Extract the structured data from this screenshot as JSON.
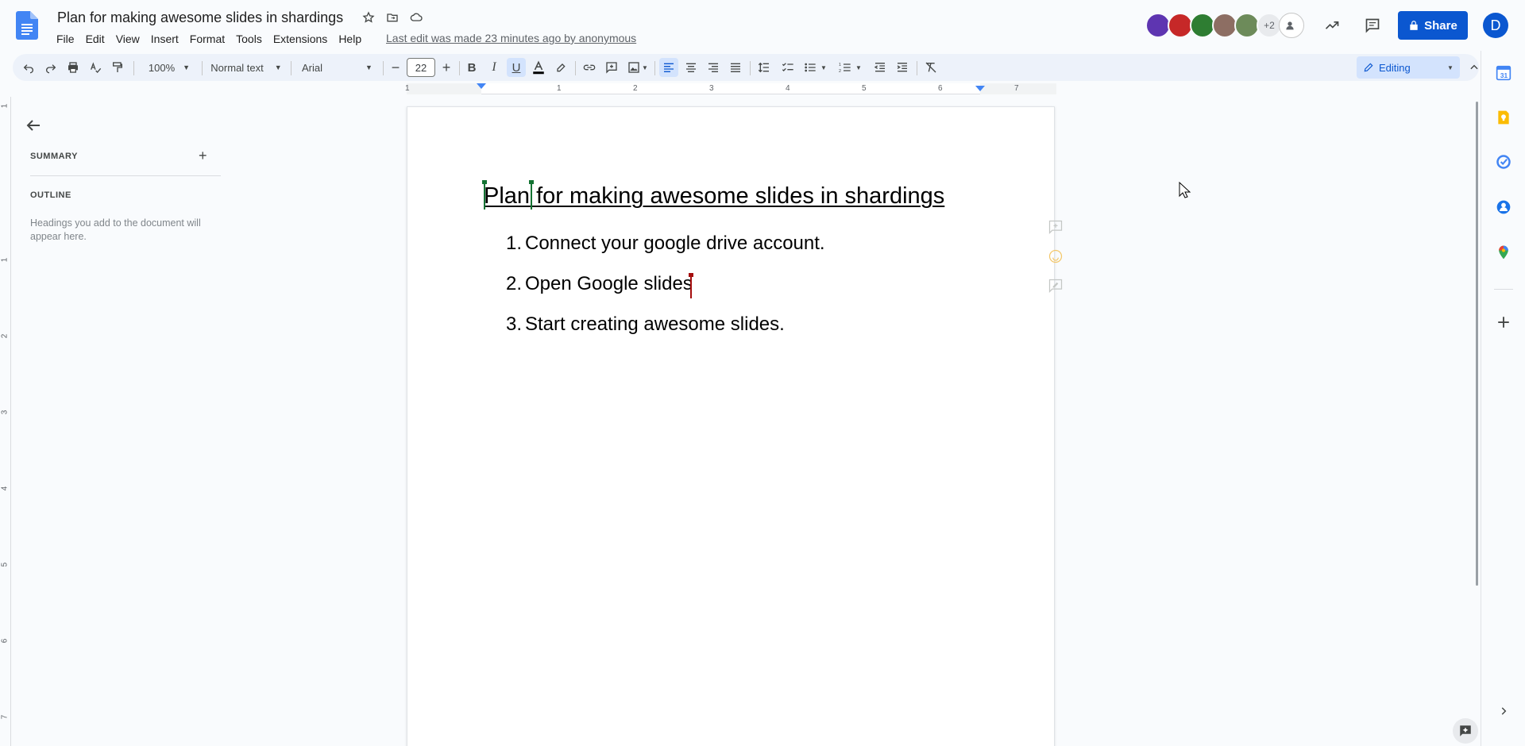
{
  "header": {
    "title": "Plan for making awesome slides in shardings",
    "last_edit": "Last edit was made 23 minutes ago by anonymous",
    "menu": [
      "File",
      "Edit",
      "View",
      "Insert",
      "Format",
      "Tools",
      "Extensions",
      "Help"
    ],
    "collaborators_more": "+2",
    "share_label": "Share",
    "user_initial": "D"
  },
  "toolbar": {
    "zoom": "100%",
    "style": "Normal text",
    "font": "Arial",
    "font_size": "22",
    "mode": "Editing"
  },
  "ruler": {
    "h_numbers": [
      "1",
      "1",
      "2",
      "3",
      "4",
      "5",
      "6",
      "7"
    ],
    "v_numbers": [
      "1",
      "1",
      "2",
      "3",
      "4",
      "5",
      "6",
      "7"
    ]
  },
  "left_panel": {
    "summary_label": "SUMMARY",
    "outline_label": "OUTLINE",
    "outline_hint": "Headings you add to the document will appear here."
  },
  "document": {
    "heading": "Plan for making awesome slides in shardings",
    "items": [
      {
        "num": "1.",
        "text": "Connect your google drive account."
      },
      {
        "num": "2.",
        "text": "Open Google slides"
      },
      {
        "num": "3.",
        "text": "Start creating awesome slides."
      }
    ]
  },
  "colors": {
    "accent": "#0b57d0",
    "toolbar_bg": "#edf2fa",
    "collaborator_green": "#137333",
    "collaborator_red": "#a50e0e"
  },
  "icons": {
    "side_panel": [
      "calendar-icon",
      "keep-icon",
      "tasks-icon",
      "contacts-icon",
      "maps-icon",
      "add-icon"
    ]
  }
}
